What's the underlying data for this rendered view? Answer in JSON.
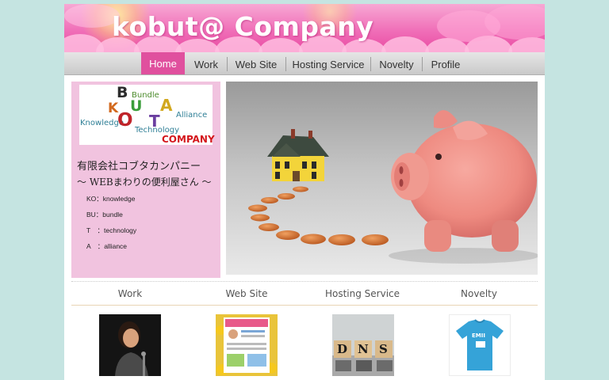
{
  "header": {
    "title": "kobut@ Company"
  },
  "nav": {
    "items": [
      {
        "label": "Home",
        "active": true
      },
      {
        "label": "Work"
      },
      {
        "label": "Web Site"
      },
      {
        "label": "Hosting Service"
      },
      {
        "label": "Novelty"
      },
      {
        "label": "Profile"
      }
    ]
  },
  "sidebar": {
    "logo": {
      "bundle": "Bundle",
      "alliance": "Alliance",
      "knowledge": "Knowledge",
      "technology": "Technology",
      "company": "COMPANY",
      "letters": [
        "K",
        "O",
        "B",
        "U",
        "T",
        "A"
      ]
    },
    "company_name": "有限会社コブタカンパニー",
    "tagline": "〜 WEBまわりの便利屋さん 〜",
    "abbreviations": [
      "KO：knowledge",
      "BU：bundle",
      "T　：technology",
      "A　：alliance"
    ]
  },
  "sections": [
    {
      "label": "Work"
    },
    {
      "label": "Web Site"
    },
    {
      "label": "Hosting Service"
    },
    {
      "label": "Novelty"
    }
  ],
  "thumbs": {
    "dns_letters": [
      "D",
      "N",
      "S"
    ],
    "shirt_text": "EMII"
  },
  "colors": {
    "background": "#c5e4e1",
    "banner_pink": "#f06fb8",
    "nav_active": "#e0509e",
    "sidebar_pink": "#f1c3df",
    "company_red": "#d4161c"
  }
}
